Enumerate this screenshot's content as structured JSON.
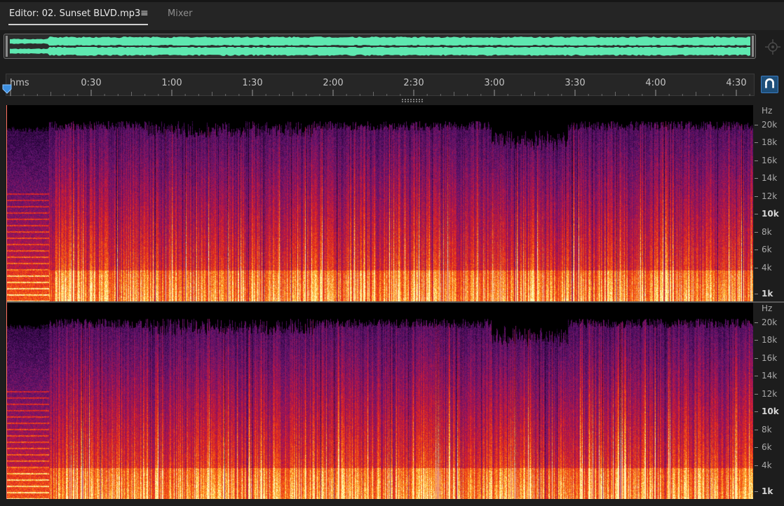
{
  "tabs": {
    "editor_label": "Editor: 02. Sunset BLVD.mp3",
    "menu_glyph": "≡",
    "mixer_label": "Mixer"
  },
  "ruler": {
    "unit": "hms",
    "labels": [
      {
        "text": "0:30",
        "seconds": 30
      },
      {
        "text": "1:00",
        "seconds": 60
      },
      {
        "text": "1:30",
        "seconds": 90
      },
      {
        "text": "2:00",
        "seconds": 120
      },
      {
        "text": "2:30",
        "seconds": 150
      },
      {
        "text": "3:00",
        "seconds": 180
      },
      {
        "text": "3:30",
        "seconds": 210
      },
      {
        "text": "4:00",
        "seconds": 240
      },
      {
        "text": "4:30",
        "seconds": 270
      }
    ]
  },
  "frequency_scale": {
    "unit": "Hz",
    "labels": [
      {
        "text": "20k",
        "bold": false
      },
      {
        "text": "18k",
        "bold": false
      },
      {
        "text": "16k",
        "bold": false
      },
      {
        "text": "14k",
        "bold": false
      },
      {
        "text": "12k",
        "bold": false
      },
      {
        "text": "10k",
        "bold": true
      },
      {
        "text": "8k",
        "bold": false
      },
      {
        "text": "6k",
        "bold": false
      },
      {
        "text": "4k",
        "bold": false
      },
      {
        "text": "1k",
        "bold": true
      }
    ]
  },
  "colors": {
    "waveform": "#5ee8b0",
    "accent": "#3c7cc0",
    "playhead": "#3d8fe0"
  },
  "icons": {
    "zoom_nav": "crosshair-zoom-icon",
    "snap": "magnet-icon",
    "playhead": "playhead-marker-icon"
  }
}
